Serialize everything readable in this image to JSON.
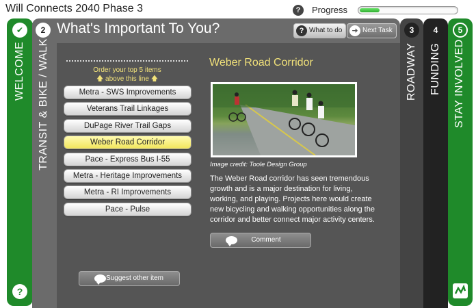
{
  "app": {
    "title": "Will Connects 2040 Phase 3"
  },
  "progress": {
    "label": "Progress",
    "value_percent": 20
  },
  "tabs": [
    {
      "number": "✔",
      "label": "WELCOME"
    },
    {
      "number": "2",
      "label": "TRANSIT & BIKE / WALK"
    },
    {
      "number": "3",
      "label": "ROADWAY"
    },
    {
      "number": "4",
      "label": "FUNDING"
    },
    {
      "number": "5",
      "label": "STAY INVOLVED"
    }
  ],
  "header": {
    "title": "What's Important To You?",
    "what_to_do": "What to do",
    "next_task": "Next Task"
  },
  "ranking": {
    "instruction_line1": "Order your top 5 items",
    "instruction_line2": "above this line",
    "items": [
      "Metra - SWS Improvements",
      "Veterans Trail Linkages",
      "DuPage River Trail Gaps",
      "Weber Road Corridor",
      "Pace - Express Bus I-55",
      "Metra - Heritage Improvements",
      "Metra - RI Improvements",
      "Pace - Pulse"
    ],
    "selected_index": 3,
    "suggest_label": "Suggest other item"
  },
  "detail": {
    "title": "Weber Road Corridor",
    "image_credit": "Image credit: Toole Design Group",
    "description": "The Weber Road corridor has seen tremendous growth and is a major destination for living, working, and playing. Projects here would create new bicycling and walking opportunities along the corridor and better connect major activity centers.",
    "comment_label": "Comment"
  },
  "colors": {
    "green": "#1f8a2a",
    "panel": "#555555",
    "highlight_text": "#f2e27a",
    "selected_item": "#f2e65c"
  },
  "icons": {
    "help": "?",
    "arrow_up": "🡅",
    "next": "➜"
  }
}
